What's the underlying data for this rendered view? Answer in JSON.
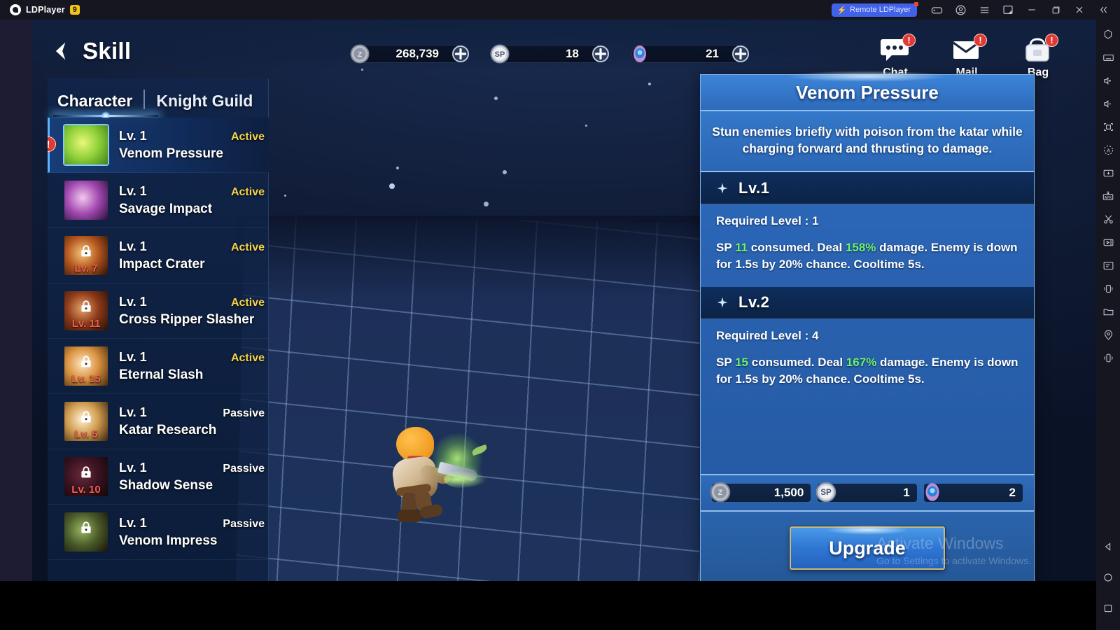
{
  "emulator": {
    "app_name": "LDPlayer",
    "version_badge": "9",
    "remote_label": "Remote LDPlayer",
    "titlebar_icons": [
      "gamepad-icon",
      "account-icon",
      "menu-icon",
      "multi-instance-icon",
      "minimize-icon",
      "maximize-icon",
      "close-icon",
      "collapse-icon"
    ],
    "sidebar_icons": [
      "fullscreen-shape-icon",
      "keyboard-icon",
      "volume-up-icon",
      "volume-down-icon",
      "screenshot-icon",
      "auto-rotate-icon",
      "video-record-icon",
      "apk-install-icon",
      "scissors-icon",
      "multi-player-icon",
      "script-icon",
      "shake-icon",
      "folder-icon",
      "location-icon",
      "rotate-icon"
    ],
    "nav_icons": [
      "back-triangle-icon",
      "home-circle-icon",
      "recents-square-icon"
    ]
  },
  "watermark": {
    "line1": "Activate Windows",
    "line2": "Go to Settings to activate Windows."
  },
  "hud": {
    "back_icon": "back-chevron-icon",
    "page_title": "Skill",
    "currencies": [
      {
        "icon": "gold-coin-icon",
        "value": "268,739",
        "plus": "+"
      },
      {
        "icon": "skill-point-icon",
        "value": "18",
        "plus": "+"
      },
      {
        "icon": "blue-gem-icon",
        "value": "21",
        "plus": "+"
      }
    ],
    "buttons": [
      {
        "icon": "chat-bubble-icon",
        "label": "Chat",
        "badge": "!"
      },
      {
        "icon": "mail-envelope-icon",
        "label": "Mail",
        "badge": "!"
      },
      {
        "icon": "bag-backpack-icon",
        "label": "Bag",
        "badge": "!"
      }
    ]
  },
  "tabs": [
    {
      "label": "Character",
      "active": true
    },
    {
      "label": "Knight Guild",
      "active": false
    }
  ],
  "skills": [
    {
      "level": "Lv. 1",
      "name": "Venom Pressure",
      "type": "Active",
      "locked": false,
      "unlock_req": "",
      "selected": true,
      "alert": true,
      "icon_colors": [
        "#eaf77a",
        "#8fd13a",
        "#3f7f18"
      ]
    },
    {
      "level": "Lv. 1",
      "name": "Savage Impact",
      "type": "Active",
      "locked": false,
      "unlock_req": "",
      "selected": false,
      "alert": false,
      "icon_colors": [
        "#f2c9ee",
        "#a44ab2",
        "#2a1038"
      ]
    },
    {
      "level": "Lv. 1",
      "name": "Impact Crater",
      "type": "Active",
      "locked": true,
      "unlock_req": "Lv. 7",
      "selected": false,
      "alert": false,
      "icon_colors": [
        "#f6c77a",
        "#b4561f",
        "#2a1206"
      ]
    },
    {
      "level": "Lv. 1",
      "name": "Cross Ripper Slasher",
      "type": "Active",
      "locked": true,
      "unlock_req": "Lv. 11",
      "selected": false,
      "alert": false,
      "icon_colors": [
        "#e8a36a",
        "#8d3a18",
        "#24100a"
      ]
    },
    {
      "level": "Lv. 1",
      "name": "Eternal Slash",
      "type": "Active",
      "locked": true,
      "unlock_req": "Lv. 15",
      "selected": false,
      "alert": false,
      "icon_colors": [
        "#ffe7c2",
        "#d8913e",
        "#4a2a10"
      ]
    },
    {
      "level": "Lv. 1",
      "name": "Katar Research",
      "type": "Passive",
      "locked": true,
      "unlock_req": "Lv. 5",
      "selected": false,
      "alert": false,
      "icon_colors": [
        "#fff3d8",
        "#cf9a4c",
        "#3a2410"
      ]
    },
    {
      "level": "Lv. 1",
      "name": "Shadow Sense",
      "type": "Passive",
      "locked": true,
      "unlock_req": "Lv. 10",
      "selected": false,
      "alert": false,
      "icon_colors": [
        "#6b2a3a",
        "#3a1320",
        "#140609"
      ]
    },
    {
      "level": "Lv. 1",
      "name": "Venom Impress",
      "type": "Passive",
      "locked": true,
      "unlock_req": "",
      "selected": false,
      "alert": false,
      "icon_colors": [
        "#9cb864",
        "#4a5c2a",
        "#1a1208"
      ]
    }
  ],
  "detail": {
    "title": "Venom Pressure",
    "description": "Stun enemies briefly with poison from the katar while charging forward and thrusting to damage.",
    "levels": [
      {
        "heading": "Lv.1",
        "required_label": "Required Level : 1",
        "stat_parts": [
          {
            "t": "SP ",
            "hl": false
          },
          {
            "t": "11",
            "hl": true
          },
          {
            "t": " consumed. Deal ",
            "hl": false
          },
          {
            "t": "158%",
            "hl": true
          },
          {
            "t": " damage. Enemy is down for 1.5s by 20% chance. Cooltime 5s.",
            "hl": false
          }
        ]
      },
      {
        "heading": "Lv.2",
        "required_label": "Required Level : 4",
        "stat_parts": [
          {
            "t": "SP ",
            "hl": false
          },
          {
            "t": "15",
            "hl": true
          },
          {
            "t": " consumed. Deal ",
            "hl": false
          },
          {
            "t": "167%",
            "hl": true
          },
          {
            "t": " damage. Enemy is down for 1.5s by 20% chance. Cooltime 5s.",
            "hl": false
          }
        ]
      }
    ],
    "costs": [
      {
        "icon": "gold-coin-icon",
        "value": "1,500"
      },
      {
        "icon": "skill-point-icon",
        "value": "1"
      },
      {
        "icon": "blue-gem-icon",
        "value": "2"
      }
    ],
    "upgrade_label": "Upgrade"
  },
  "colors": {
    "accent_blue": "#2f6fc4",
    "highlight_green": "#6ef06e",
    "active_yellow": "#f3d44a",
    "alert_red": "#e03a34",
    "lock_red": "#f0604f",
    "gold_border": "#cbb97a"
  }
}
